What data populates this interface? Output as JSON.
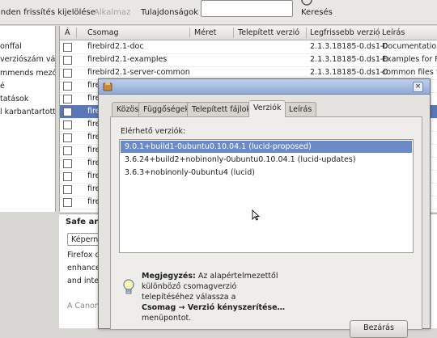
{
  "toolbar": {
    "reload_label": "inden frissítés kijelölése",
    "apply_label": "Alkalmaz",
    "properties_label": "Tulajdonságok",
    "search_label": "Keresés",
    "search_value": ""
  },
  "sidebar": {
    "items": [
      {
        "label": "onffal"
      },
      {
        "label": "verziószám vál"
      },
      {
        "label": "mmends mező"
      },
      {
        "label": "é"
      },
      {
        "label": "tatások"
      },
      {
        "label": "l karbantartott ("
      }
    ]
  },
  "package_table": {
    "columns": [
      "Á",
      "Csomag",
      "Méret",
      "Telepített verzió",
      "Legfrissebb verzió",
      "Leírás"
    ],
    "rows": [
      {
        "name": "firebird2.1-doc",
        "latest": "2.1.3.18185-0.ds1-0",
        "desc": "Documentation",
        "selected": false
      },
      {
        "name": "firebird2.1-examples",
        "latest": "2.1.3.18185-0.ds1-0",
        "desc": "Examples for Fir",
        "selected": false
      },
      {
        "name": "firebird2.1-server-common",
        "latest": "2.1.3.18185-0.ds1-0",
        "desc": "common files fo",
        "selected": false
      },
      {
        "name": "firefo",
        "latest": "",
        "desc": "",
        "selected": false
      },
      {
        "name": "firefo",
        "latest": "",
        "desc": "",
        "selected": false
      },
      {
        "name": "firefo",
        "latest": "",
        "desc": "sy w",
        "selected": true
      },
      {
        "name": "firefo",
        "latest": "",
        "desc": "sy w",
        "selected": false
      },
      {
        "name": "firefo",
        "latest": "",
        "desc": "sy w",
        "selected": false
      },
      {
        "name": "firefo",
        "latest": "",
        "desc": "sy w",
        "selected": false
      },
      {
        "name": "firefo",
        "latest": "",
        "desc": "sy w",
        "selected": false
      },
      {
        "name": "firefo",
        "latest": "",
        "desc": "sy w",
        "selected": false
      },
      {
        "name": "firefo",
        "latest": "",
        "desc": "sy w",
        "selected": false
      },
      {
        "name": "firefo",
        "latest": "",
        "desc": "sy w",
        "selected": false
      }
    ]
  },
  "info_panel": {
    "title": "Safe an",
    "button_label": "Képerny",
    "line1": "Firefox de",
    "line2": "enhanced",
    "line3": "and integ",
    "footer": "A Canoni"
  },
  "dialog": {
    "tabs": [
      "Közös",
      "Függőségek",
      "Telepített fájlok",
      "Verziók",
      "Leírás"
    ],
    "active_tab": "Verziók",
    "versions_label": "Elérhető verziók:",
    "versions": [
      "9.0.1+build1-0ubuntu0.10.04.1 (lucid-proposed)",
      "3.6.24+build2+nobinonly-0ubuntu0.10.04.1 (lucid-updates)",
      "3.6.3+nobinonly-0ubuntu4 (lucid)"
    ],
    "note_bold": "Megjegyzés:",
    "note_text": "Az alapértelmezettől különböző csomagverzió telepítéséhez válassza a",
    "note_menu": "Csomag → Verzió kényszerítése…",
    "note_end": "menüpontot.",
    "close_label": "Bezárás"
  },
  "colors": {
    "selection": "#5a78b8",
    "titlebar": "#8fa9d6",
    "window_bg": "#e5e3df"
  }
}
